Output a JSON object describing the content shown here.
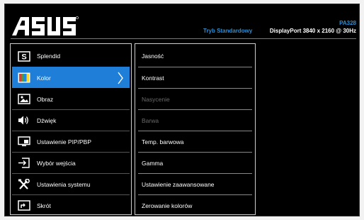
{
  "header": {
    "brand": "ASUS",
    "model": "PA328",
    "mode": "Tryb Standardowy",
    "input_status": "DisplayPort  3840 x 2160 @ 30Hz"
  },
  "colors": {
    "accent": "#1e7ed8",
    "info_text": "#2a8fd6",
    "disabled_text": "#6a6a6a"
  },
  "main_menu": [
    {
      "label": "Splendid",
      "icon": "splendid-s-icon",
      "active": false
    },
    {
      "label": "Kolor",
      "icon": "color-bars-icon",
      "active": true
    },
    {
      "label": "Obraz",
      "icon": "image-icon",
      "active": false
    },
    {
      "label": "Dźwięk",
      "icon": "speaker-icon",
      "active": false
    },
    {
      "label": "Ustawienie PIP/PBP",
      "icon": "pip-icon",
      "active": false
    },
    {
      "label": "Wybór wejścia",
      "icon": "input-select-icon",
      "active": false
    },
    {
      "label": "Ustawienia systemu",
      "icon": "tools-icon",
      "active": false
    },
    {
      "label": "Skrót",
      "icon": "shortcut-icon",
      "active": false
    }
  ],
  "sub_menu": [
    {
      "label": "Jasność",
      "enabled": true
    },
    {
      "label": "Kontrast",
      "enabled": true
    },
    {
      "label": "Nasycenie",
      "enabled": false
    },
    {
      "label": "Barwa",
      "enabled": false
    },
    {
      "label": "Temp. barwowa",
      "enabled": true
    },
    {
      "label": "Gamma",
      "enabled": true
    },
    {
      "label": "Ustawienie zaawansowane",
      "enabled": true
    },
    {
      "label": "Zerowanie kolorów",
      "enabled": true
    }
  ]
}
